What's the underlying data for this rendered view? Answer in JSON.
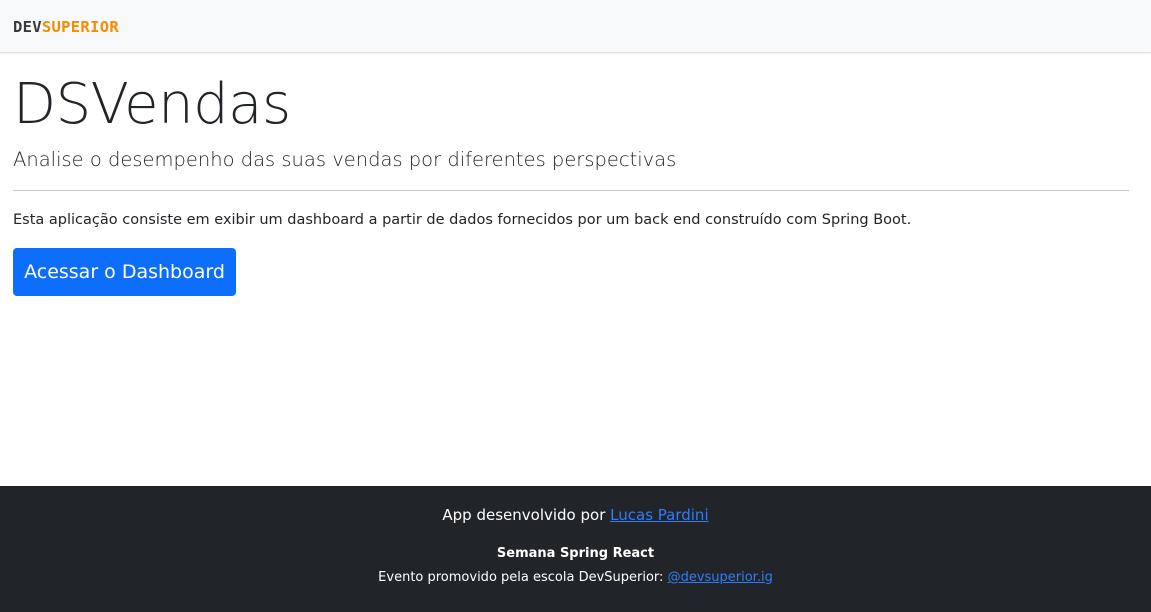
{
  "navbar": {
    "logo_dev": "DEV",
    "logo_superior": "SUPERIOR",
    "bg_color": "#f8f9fa",
    "logo_accent_color": "#f78c00"
  },
  "main": {
    "title": "DSVendas",
    "lead": "Analise o desempenho das suas vendas por diferentes perspectivas",
    "description": "Esta aplicação consiste em exibir um dashboard a partir de dados fornecidos por um back end construído com Spring Boot.",
    "cta_label": "Acessar o Dashboard",
    "cta_color": "#0d6efd"
  },
  "footer": {
    "bg_color": "#212529",
    "line1_prefix": "App desenvolvido por",
    "author_link": "Lucas Pardini",
    "event_title": "Semana Spring React",
    "line3_prefix": "Evento promovido pela escola DevSuperior:",
    "instagram_link": "@devsuperior.ig",
    "link_color": "#2f7dfc"
  }
}
